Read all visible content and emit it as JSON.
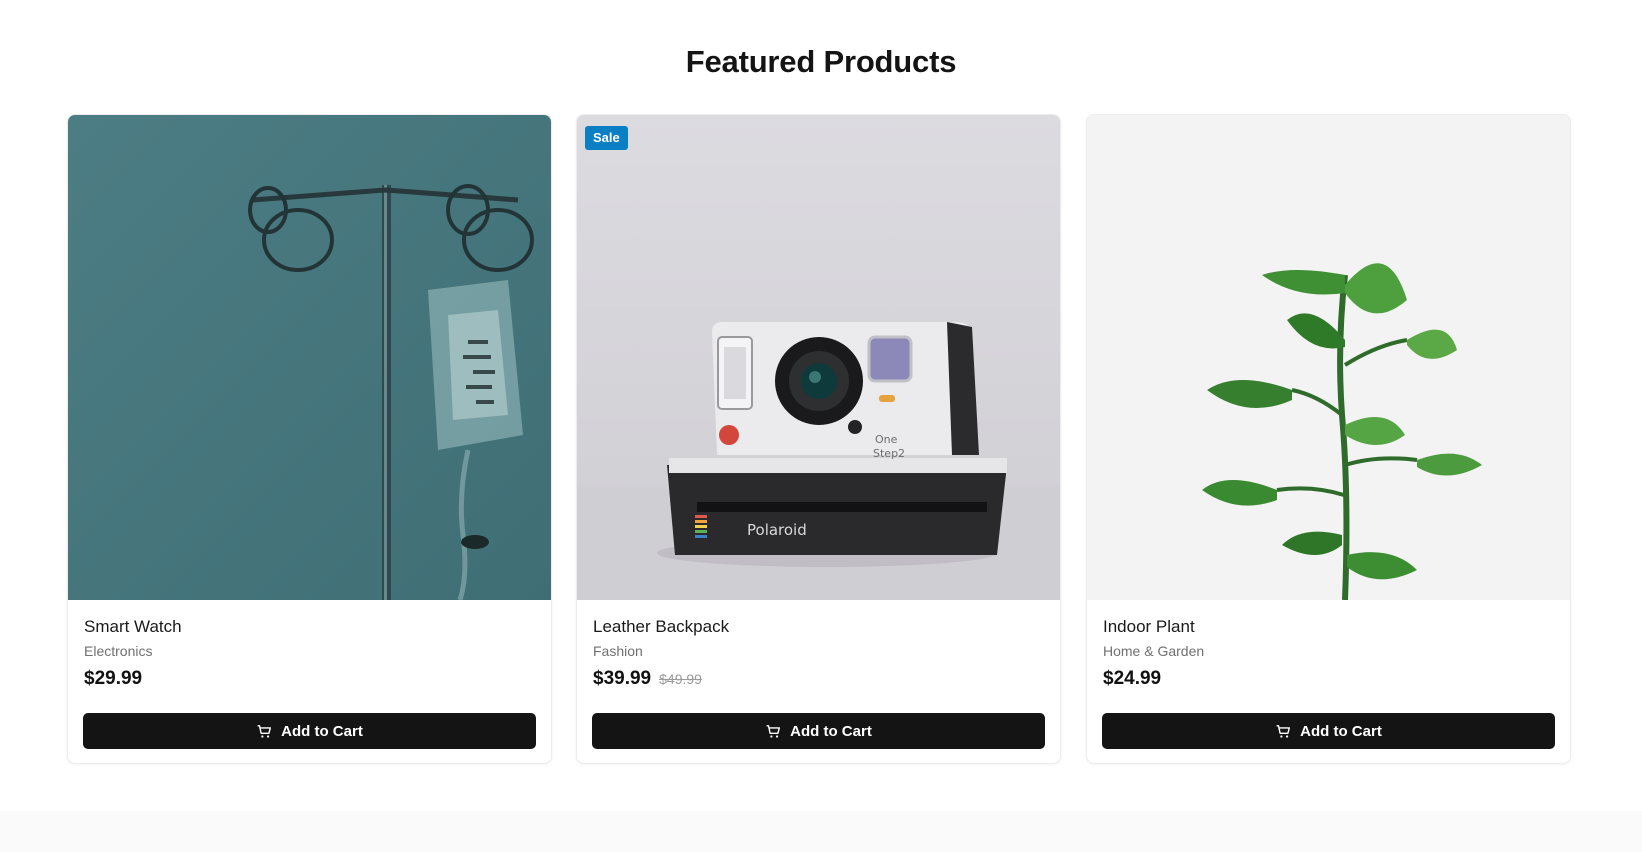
{
  "section": {
    "title": "Featured Products"
  },
  "products": [
    {
      "name": "Smart Watch",
      "category": "Electronics",
      "price": "$29.99",
      "old_price": "",
      "badge": "",
      "button_label": "Add to Cart",
      "image": "iv-drip-stand-photo"
    },
    {
      "name": "Leather Backpack",
      "category": "Fashion",
      "price": "$39.99",
      "old_price": "$49.99",
      "badge": "Sale",
      "button_label": "Add to Cart",
      "image": "instant-camera-photo"
    },
    {
      "name": "Indoor Plant",
      "category": "Home & Garden",
      "price": "$24.99",
      "old_price": "",
      "badge": "",
      "button_label": "Add to Cart",
      "image": "potted-plant-photo"
    }
  ],
  "icons": {
    "cart": "shopping-cart-icon"
  },
  "colors": {
    "accent_badge": "#0a7fc4",
    "button_bg": "#141414",
    "teal_photo_bg": "#4a7a80"
  }
}
